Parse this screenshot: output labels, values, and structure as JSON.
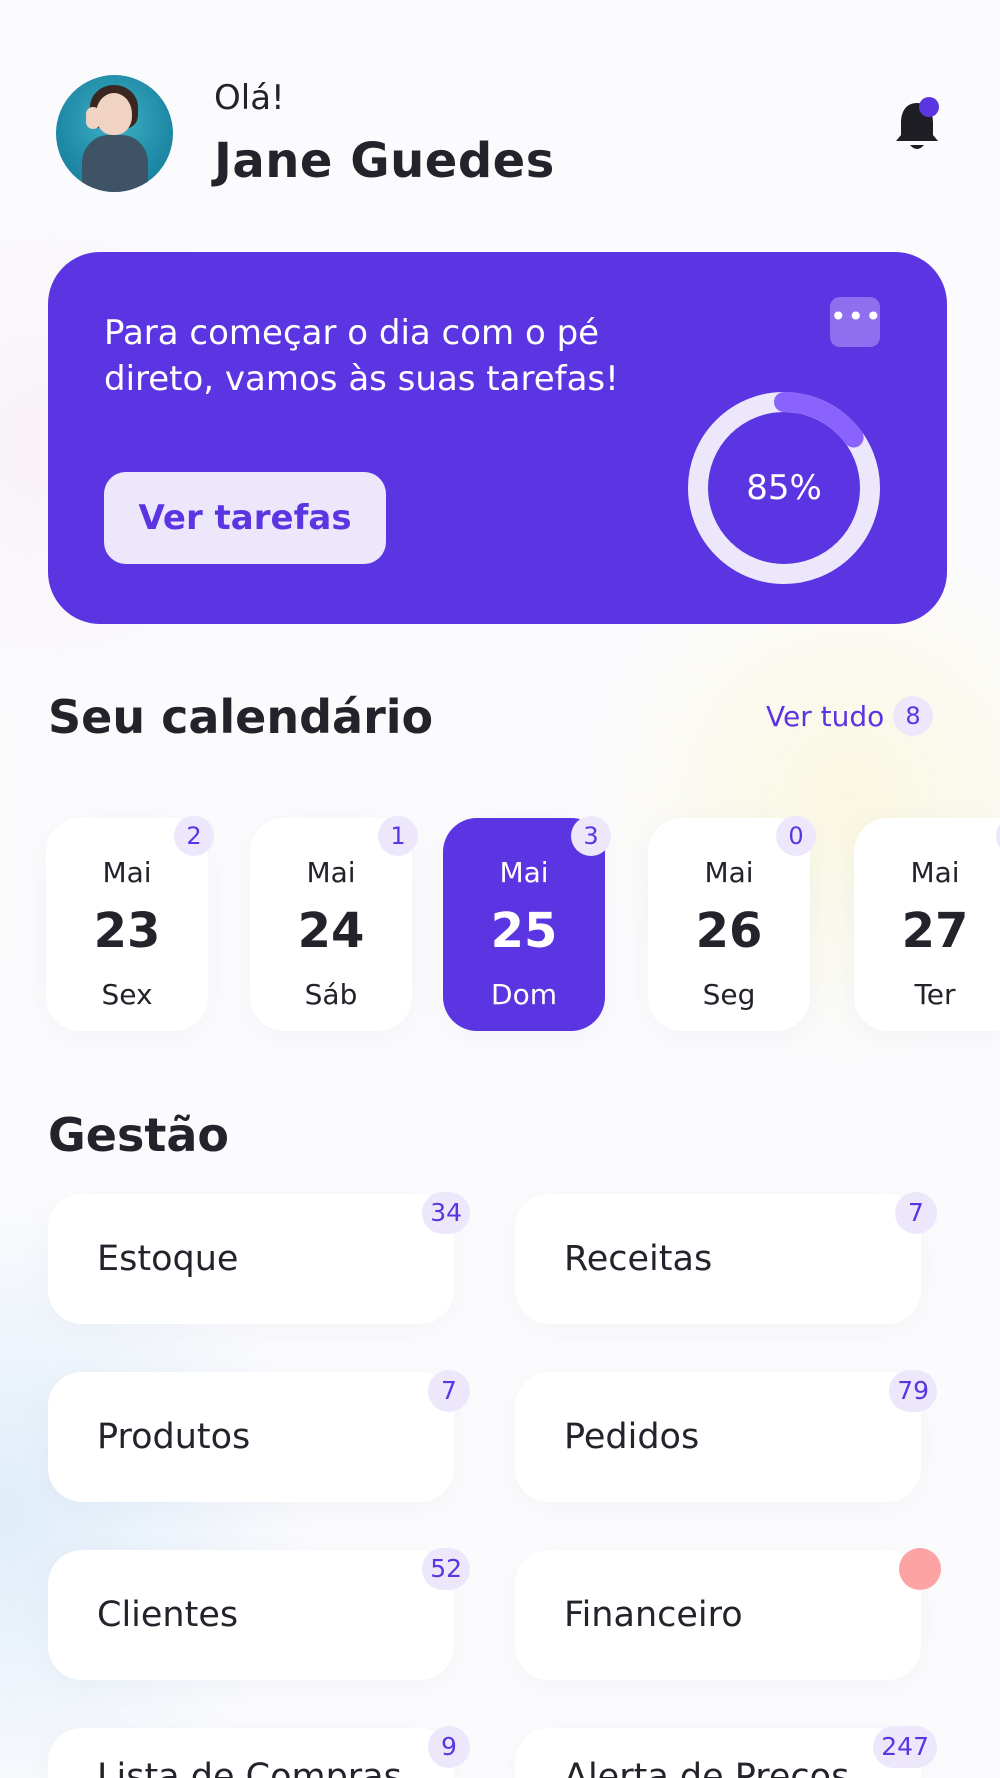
{
  "header": {
    "greeting": "Olá!",
    "user_name": "Jane Guedes",
    "avatar_icon": "user-avatar-photo",
    "notification_icon": "bell-icon",
    "has_unread": true
  },
  "hero": {
    "message": "Para começar o dia com o pé direto, vamos às suas tarefas!",
    "more_icon": "more-horizontal-icon",
    "more_label": "•••",
    "button_label": "Ver tarefas",
    "progress_label": "85%",
    "progress_value": 0.85
  },
  "calendar": {
    "title": "Seu calendário",
    "see_all_label": "Ver tudo",
    "see_all_count": "8",
    "days": [
      {
        "month": "Mai",
        "day": "23",
        "weekday": "Sex",
        "count": "2",
        "active": false
      },
      {
        "month": "Mai",
        "day": "24",
        "weekday": "Sáb",
        "count": "1",
        "active": false
      },
      {
        "month": "Mai",
        "day": "25",
        "weekday": "Dom",
        "count": "3",
        "active": true
      },
      {
        "month": "Mai",
        "day": "26",
        "weekday": "Seg",
        "count": "0",
        "active": false
      },
      {
        "month": "Mai",
        "day": "27",
        "weekday": "Ter",
        "count": "",
        "active": false
      }
    ]
  },
  "management": {
    "title": "Gestão",
    "items": [
      {
        "label": "Estoque",
        "count": "34"
      },
      {
        "label": "Receitas",
        "count": "7"
      },
      {
        "label": "Produtos",
        "count": "7"
      },
      {
        "label": "Pedidos",
        "count": "79"
      },
      {
        "label": "Clientes",
        "count": "52"
      },
      {
        "label": "Financeiro",
        "count": ""
      },
      {
        "label": "Lista de Compras",
        "count": "9"
      },
      {
        "label": "Alerta de Preços",
        "count": "247"
      }
    ]
  },
  "colors": {
    "accent": "#5c35e2",
    "badge_bg": "#ece7fb",
    "alert": "#fea3a3"
  }
}
